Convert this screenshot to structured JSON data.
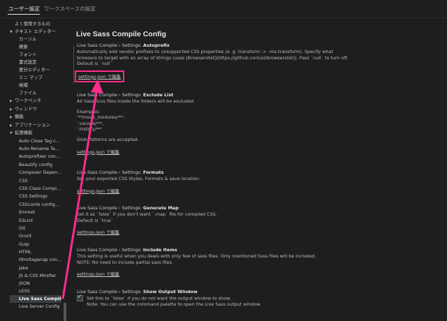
{
  "tabs": [
    {
      "label": "ユーザー設定"
    },
    {
      "label": "ワークスペースの設定"
    }
  ],
  "sidebar": {
    "items": [
      {
        "label": "よく使用するもの"
      },
      {
        "label": "テキスト エディター"
      },
      {
        "label": "カーソル"
      },
      {
        "label": "検索"
      },
      {
        "label": "フォント"
      },
      {
        "label": "書式設定"
      },
      {
        "label": "差分エディター"
      },
      {
        "label": "ミニ マップ"
      },
      {
        "label": "候補"
      },
      {
        "label": "ファイル"
      },
      {
        "label": "ワークベンチ"
      },
      {
        "label": "ウィンドウ"
      },
      {
        "label": "機能"
      },
      {
        "label": "アプリケーション"
      },
      {
        "label": "拡張機能"
      },
      {
        "label": "Auto Close Tag con..."
      },
      {
        "label": "Auto Rename Tag c..."
      },
      {
        "label": "Autoprefixer config..."
      },
      {
        "label": "Beautify config"
      },
      {
        "label": "Composer Depend..."
      },
      {
        "label": "CSS"
      },
      {
        "label": "CSS Class Completi..."
      },
      {
        "label": "CSS Settings"
      },
      {
        "label": "CSScomb configura..."
      },
      {
        "label": "Emmet"
      },
      {
        "label": "ESLint"
      },
      {
        "label": "Git"
      },
      {
        "label": "Grunt"
      },
      {
        "label": "Gulp"
      },
      {
        "label": "HTML"
      },
      {
        "label": "Htmltagwrap config..."
      },
      {
        "label": "Jake"
      },
      {
        "label": "JS & CSS Minifier"
      },
      {
        "label": "JSON"
      },
      {
        "label": "LESS"
      },
      {
        "label": "Live Sass Compile..."
      },
      {
        "label": "Live Server Config"
      }
    ]
  },
  "main": {
    "title": "Live Sass Compile Config",
    "settings": [
      {
        "prefix": "Live Sass Compile › Settings: ",
        "name": "Autoprefix",
        "desc1": "Automatically add vendor prefixes to unsupported CSS properties (e. g. transform -> -ms-transform). Specify what browsers to target with an array of strings (uses [Browserslist](https://github.com/ai/browserslist)). Pass `null` to turn off.",
        "desc2": "Default is `null`",
        "link": "settings.json で編集"
      },
      {
        "prefix": "Live Sass Compile › Settings: ",
        "name": "Exclude List",
        "desc1": "All Sass/Scss files inside the folders will be excluded.",
        "ex_head": "Examples:",
        "ex1": "'**/node_modules/**',",
        "ex2": "'.vscode/**',",
        "ex3": "'.history/**'",
        "desc2": "Glob Patterns are accepted.",
        "link": "settings.json で編集"
      },
      {
        "prefix": "Live Sass Compile › Settings: ",
        "name": "Formats",
        "desc1": "Set your exported CSS Styles, Formats & save location.",
        "link": "settings.json で編集"
      },
      {
        "prefix": "Live Sass Compile › Settings: ",
        "name": "Generate Map",
        "desc1": "Set it as `false` if you don't want `.map` file for compiled CSS.",
        "desc2": "Default is `true`",
        "link": "settings.json で編集"
      },
      {
        "prefix": "Live Sass Compile › Settings: ",
        "name": "Include Items",
        "desc1": "This setting is useful when you deals with only few of sass files. Only mentioned Sass files will be included.",
        "desc2": "NOTE: No need to include partial sass files.",
        "link": "settings.json で編集"
      },
      {
        "prefix": "Live Sass Compile › Settings: ",
        "name": "Show Output Window",
        "desc1": "Set this to `false` if you do not want the output window to show.",
        "desc2": "Note: You can use the command palette to open the Live Sass output window.",
        "checked": true
      }
    ]
  },
  "colors": {
    "accent": "#ff2d8a",
    "background": "#1e1e1e",
    "selection": "#3a3d41"
  }
}
